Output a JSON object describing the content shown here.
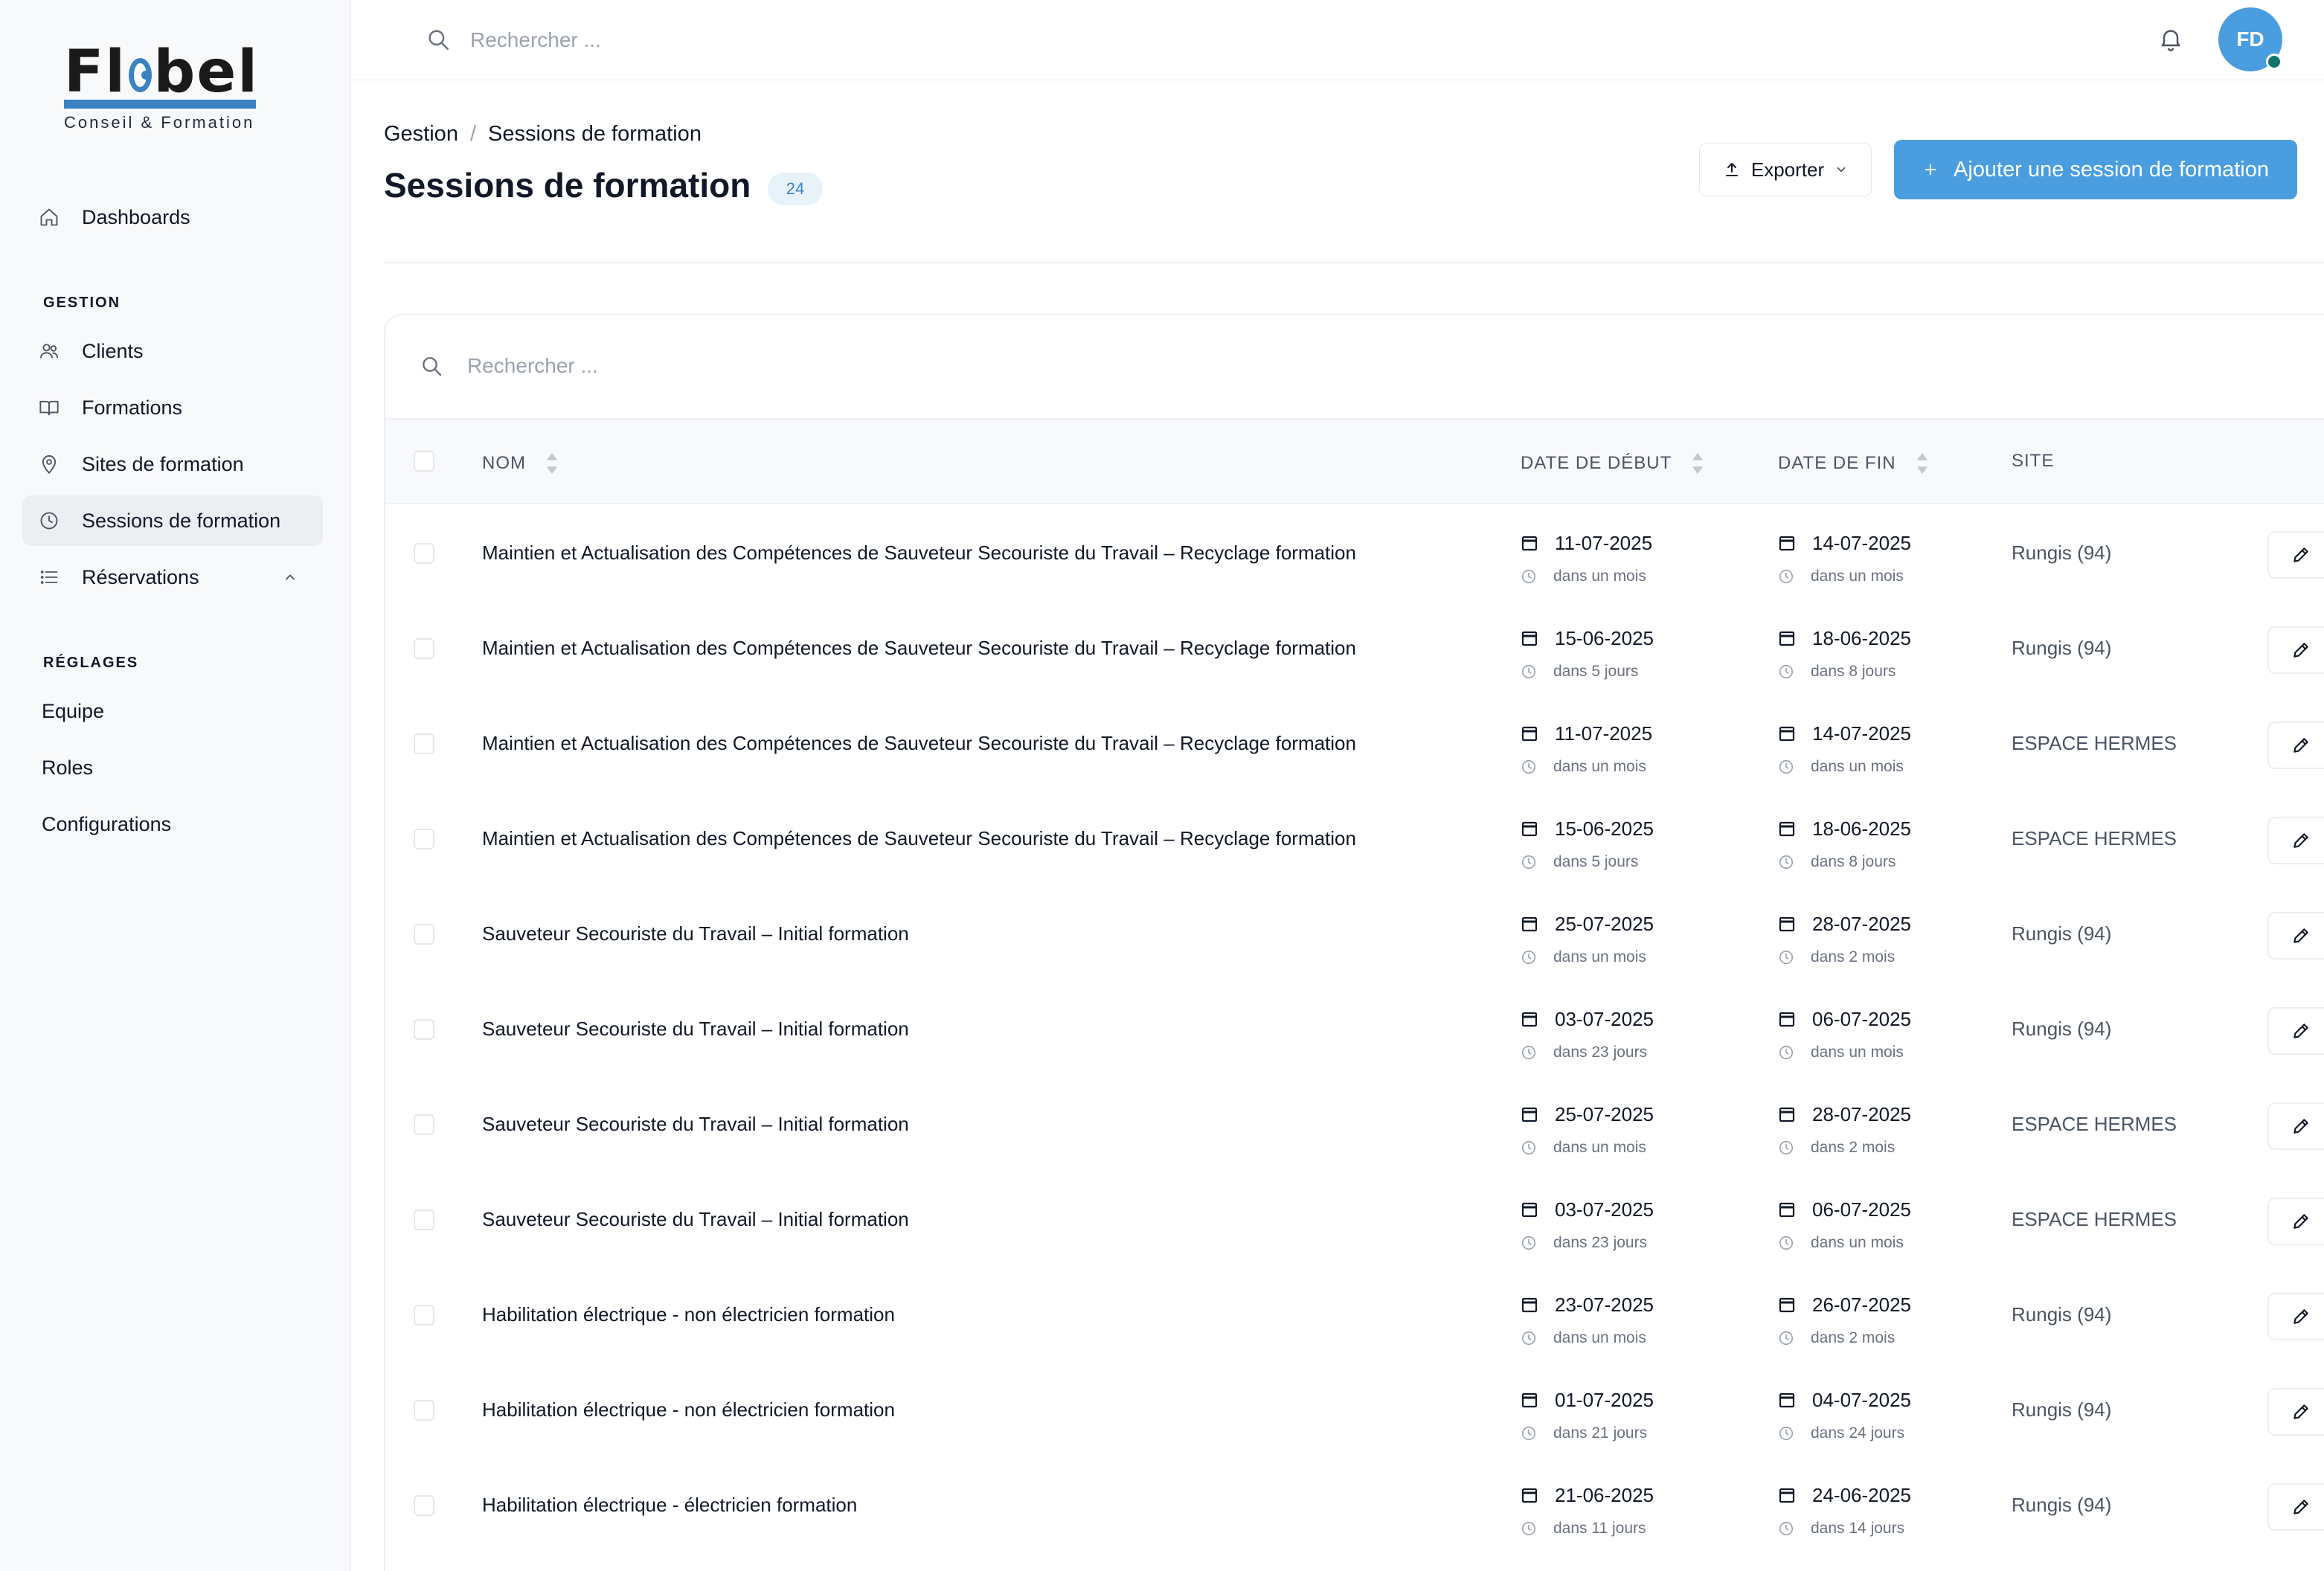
{
  "app": {
    "logo_text": "Flobel",
    "logo_tagline": "Conseil & Formation"
  },
  "sidebar": {
    "dashboards": "Dashboards",
    "section_gestion": "GESTION",
    "section_reglages": "RÉGLAGES",
    "gestion_items": [
      {
        "label": "Clients",
        "icon": "users-icon"
      },
      {
        "label": "Formations",
        "icon": "book-icon"
      },
      {
        "label": "Sites de formation",
        "icon": "map-pin-icon"
      },
      {
        "label": "Sessions de formation",
        "icon": "clock-icon",
        "active": true
      },
      {
        "label": "Réservations",
        "icon": "list-icon",
        "expandable": true
      }
    ],
    "reglages_items": [
      "Equipe",
      "Roles",
      "Configurations"
    ]
  },
  "topbar": {
    "search_placeholder": "Rechercher ...",
    "avatar_initials": "FD"
  },
  "header": {
    "breadcrumb_root": "Gestion",
    "breadcrumb_sep": "/",
    "breadcrumb_current": "Sessions de formation",
    "title": "Sessions de formation",
    "count": "24",
    "export_label": "Exporter",
    "add_label": "Ajouter une session de formation"
  },
  "table": {
    "search_placeholder": "Rechercher ...",
    "columns": {
      "name": "NOM",
      "start": "DATE DE DÉBUT",
      "end": "DATE DE FIN",
      "site": "SITE"
    },
    "rows": [
      {
        "name": "Maintien et Actualisation des Compétences de Sauveteur Secouriste du Travail – Recyclage formation",
        "start": "11-07-2025",
        "start_rel": "dans un mois",
        "end": "14-07-2025",
        "end_rel": "dans un mois",
        "site": "Rungis (94)"
      },
      {
        "name": "Maintien et Actualisation des Compétences de Sauveteur Secouriste du Travail – Recyclage formation",
        "start": "15-06-2025",
        "start_rel": "dans 5 jours",
        "end": "18-06-2025",
        "end_rel": "dans 8 jours",
        "site": "Rungis (94)"
      },
      {
        "name": "Maintien et Actualisation des Compétences de Sauveteur Secouriste du Travail – Recyclage formation",
        "start": "11-07-2025",
        "start_rel": "dans un mois",
        "end": "14-07-2025",
        "end_rel": "dans un mois",
        "site": "ESPACE HERMES"
      },
      {
        "name": "Maintien et Actualisation des Compétences de Sauveteur Secouriste du Travail – Recyclage formation",
        "start": "15-06-2025",
        "start_rel": "dans 5 jours",
        "end": "18-06-2025",
        "end_rel": "dans 8 jours",
        "site": "ESPACE HERMES"
      },
      {
        "name": "Sauveteur Secouriste du Travail – Initial formation",
        "start": "25-07-2025",
        "start_rel": "dans un mois",
        "end": "28-07-2025",
        "end_rel": "dans 2 mois",
        "site": "Rungis (94)"
      },
      {
        "name": "Sauveteur Secouriste du Travail – Initial formation",
        "start": "03-07-2025",
        "start_rel": "dans 23 jours",
        "end": "06-07-2025",
        "end_rel": "dans un mois",
        "site": "Rungis (94)"
      },
      {
        "name": "Sauveteur Secouriste du Travail – Initial formation",
        "start": "25-07-2025",
        "start_rel": "dans un mois",
        "end": "28-07-2025",
        "end_rel": "dans 2 mois",
        "site": "ESPACE HERMES"
      },
      {
        "name": "Sauveteur Secouriste du Travail – Initial formation",
        "start": "03-07-2025",
        "start_rel": "dans 23 jours",
        "end": "06-07-2025",
        "end_rel": "dans un mois",
        "site": "ESPACE HERMES"
      },
      {
        "name": "Habilitation électrique - non électricien formation",
        "start": "23-07-2025",
        "start_rel": "dans un mois",
        "end": "26-07-2025",
        "end_rel": "dans 2 mois",
        "site": "Rungis (94)"
      },
      {
        "name": "Habilitation électrique - non électricien formation",
        "start": "01-07-2025",
        "start_rel": "dans 21 jours",
        "end": "04-07-2025",
        "end_rel": "dans 24 jours",
        "site": "Rungis (94)"
      },
      {
        "name": "Habilitation électrique - électricien formation",
        "start": "21-06-2025",
        "start_rel": "dans 11 jours",
        "end": "24-06-2025",
        "end_rel": "dans 14 jours",
        "site": "Rungis (94)"
      }
    ]
  },
  "colors": {
    "accent": "#4a9ee0",
    "logo_blue": "#3b82c4",
    "badge_bg": "#e8f2fb",
    "presence": "#0f766e"
  }
}
